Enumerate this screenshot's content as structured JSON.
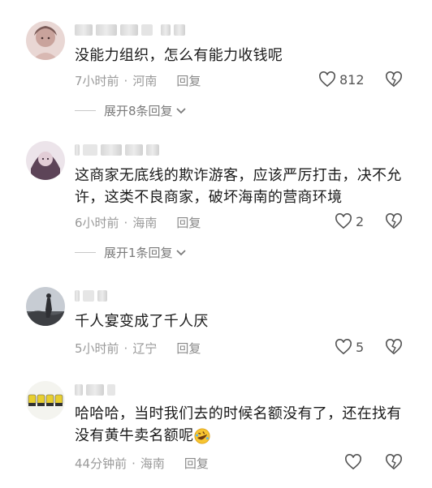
{
  "comments": [
    {
      "text": "没能力组织，怎么有能力收钱呢",
      "time": "7小时前",
      "location": "河南",
      "reply_label": "回复",
      "likes": "812",
      "expand_label": "展开8条回复"
    },
    {
      "text": "这商家无底线的欺诈游客，应该严厉打击，决不允许，这类不良商家，破坏海南的营商环境",
      "time": "6小时前",
      "location": "海南",
      "reply_label": "回复",
      "likes": "2",
      "expand_label": "展开1条回复"
    },
    {
      "text": "千人宴变成了千人厌",
      "time": "5小时前",
      "location": "辽宁",
      "reply_label": "回复",
      "likes": "5"
    },
    {
      "text": "哈哈哈，当时我们去的时候名额没有了，还在找有没有黄牛卖名额呢",
      "time": "44分钟前",
      "location": "海南",
      "reply_label": "回复",
      "likes": ""
    }
  ],
  "icons": {
    "like": "heart-outline-icon",
    "dislike": "broken-heart-icon",
    "expand": "chevron-down-icon",
    "emoji": "rofl-emoji-icon"
  },
  "colors": {
    "text": "#1b1b1b",
    "meta": "#9a9a9a",
    "background": "#ffffff"
  }
}
